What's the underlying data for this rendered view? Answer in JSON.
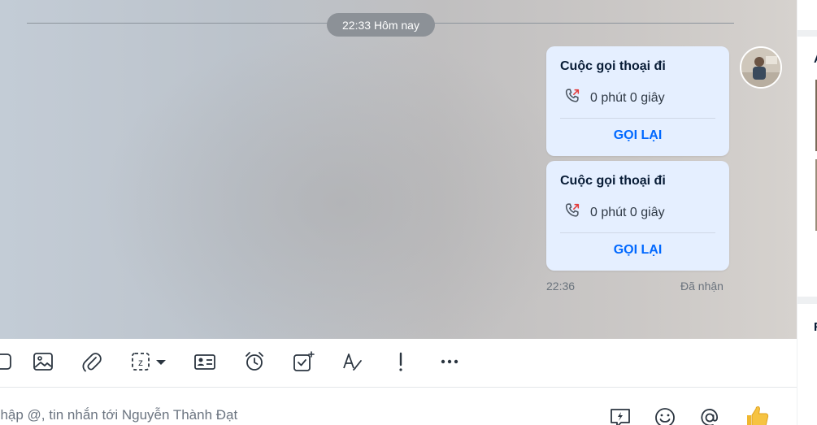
{
  "chat": {
    "date_separator": "22:33 Hôm nay",
    "calls": [
      {
        "title": "Cuộc gọi thoại đi",
        "duration": "0 phút 0 giây",
        "action": "GỌI LẠI"
      },
      {
        "title": "Cuộc gọi thoại đi",
        "duration": "0 phút 0 giây",
        "action": "GỌI LẠI"
      }
    ],
    "last_time": "22:36",
    "status": "Đã nhận"
  },
  "composer": {
    "placeholder": "nhập @, tin nhắn tới Nguyễn Thành Đạt"
  },
  "right_panel": {
    "letters": [
      "A",
      "F"
    ]
  },
  "colors": {
    "accent": "#0068ff",
    "bubble": "#e5efff"
  }
}
